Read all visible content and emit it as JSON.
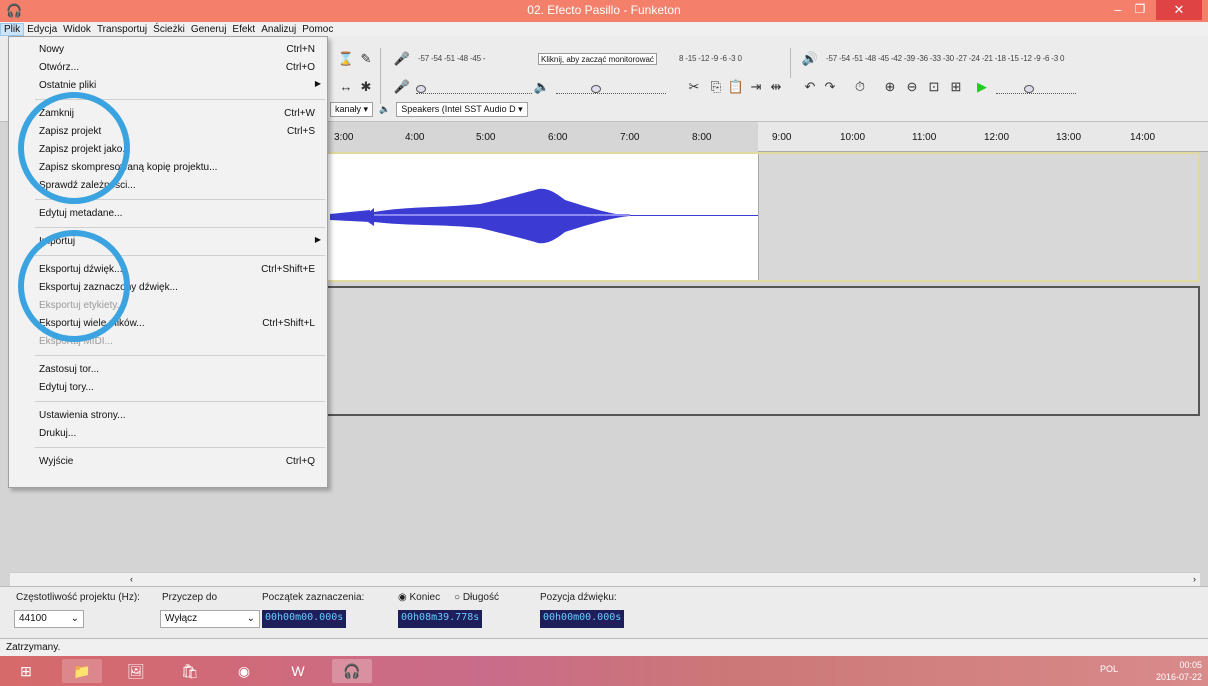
{
  "window": {
    "title": "02. Efecto Pasillo - Funketon"
  },
  "menubar": [
    "Plik",
    "Edycja",
    "Widok",
    "Transportuj",
    "Ścieżki",
    "Generuj",
    "Efekt",
    "Analizuj",
    "Pomoc"
  ],
  "toolbar": {
    "monitor_label": "Kliknij, aby zacząć monitorować",
    "record_scale_left": "-57 -54 -51 -48 -45 -",
    "record_scale_right": "8 -15 -12 -9 -6 -3 0",
    "playback_scale": "-57 -54 -51 -48 -45 -42 -39 -36 -33 -30 -27 -24 -21 -18 -15 -12 -9 -6 -3 0",
    "channels_label": "kanały",
    "speaker_device": "Speakers (Intel SST Audio D"
  },
  "timeline_ticks": [
    "3:00",
    "4:00",
    "5:00",
    "6:00",
    "7:00",
    "8:00",
    "9:00",
    "10:00",
    "11:00",
    "12:00",
    "13:00",
    "14:00"
  ],
  "file_menu": {
    "items": [
      {
        "label": "Nowy",
        "shortcut": "Ctrl+N"
      },
      {
        "label": "Otwórz...",
        "shortcut": "Ctrl+O"
      },
      {
        "label": "Ostatnie pliki",
        "shortcut": ""
      },
      {
        "label": "Zamknij",
        "shortcut": "Ctrl+W"
      },
      {
        "label": "Zapisz projekt",
        "shortcut": "Ctrl+S"
      },
      {
        "label": "Zapisz projekt jako...",
        "shortcut": ""
      },
      {
        "label": "Zapisz skompresowaną kopię projektu...",
        "shortcut": ""
      },
      {
        "label": "Sprawdź zależności...",
        "shortcut": ""
      },
      {
        "label": "Edytuj metadane...",
        "shortcut": ""
      },
      {
        "label": "Importuj",
        "shortcut": ""
      },
      {
        "label": "Eksportuj dźwięk...",
        "shortcut": "Ctrl+Shift+E"
      },
      {
        "label": "Eksportuj zaznaczony dźwięk...",
        "shortcut": ""
      },
      {
        "label": "Eksportuj etykiety...",
        "shortcut": ""
      },
      {
        "label": "Eksportuj wiele plików...",
        "shortcut": "Ctrl+Shift+L"
      },
      {
        "label": "Eksportuj MIDI...",
        "shortcut": ""
      },
      {
        "label": "Zastosuj tor...",
        "shortcut": ""
      },
      {
        "label": "Edytuj tory...",
        "shortcut": ""
      },
      {
        "label": "Ustawienia strony...",
        "shortcut": ""
      },
      {
        "label": "Drukuj...",
        "shortcut": ""
      },
      {
        "label": "Wyjście",
        "shortcut": "Ctrl+Q"
      }
    ]
  },
  "selection_bar": {
    "rate_label": "Częstotliwość projektu (Hz):",
    "rate_value": "44100",
    "snap_label": "Przyczep do",
    "snap_value": "Wyłącz",
    "start_label": "Początek zaznaczenia:",
    "end_option": "Koniec",
    "length_option": "Długość",
    "position_label": "Pozycja dźwięku:",
    "start_time": "00h00m00.000s",
    "end_time": "00h08m39.778s",
    "position_time": "00h00m00.000s"
  },
  "status": "Zatrzymany.",
  "taskbar": {
    "language": "POL",
    "time": "00:05",
    "date": "2016-07-22"
  },
  "colors": {
    "titlebar": "#f4806b",
    "waveform": "#3b3bd4",
    "annotation_circle": "#3ba4e0"
  }
}
